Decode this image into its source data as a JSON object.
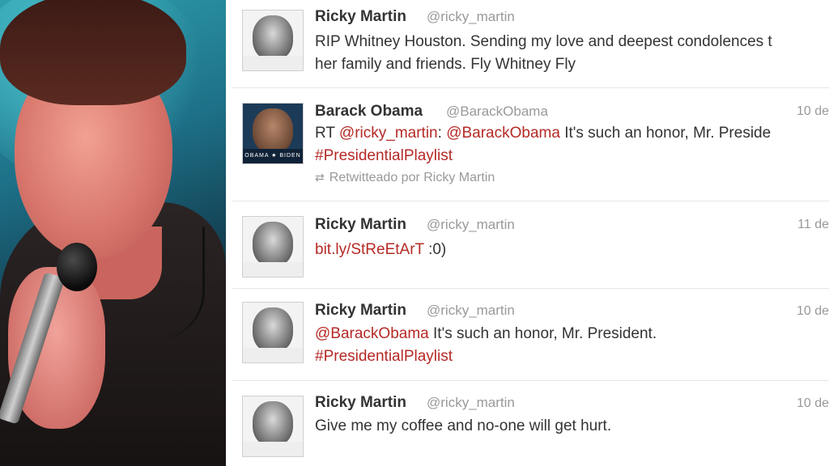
{
  "tweets": [
    {
      "name": "Ricky Martin",
      "handle": "@ricky_martin",
      "date": "",
      "text_line1": "RIP Whitney Houston. Sending my love and deepest condolences t",
      "text_line2": "her family and friends. Fly Whitney Fly",
      "avatar": "ricky-avatar"
    },
    {
      "name": "Barack Obama",
      "handle": "@BarackObama",
      "date": "10 de",
      "rt_prefix": "RT ",
      "mention1": "@ricky_martin",
      "colon": ": ",
      "mention2": "@BarackObama",
      "rest": " It's such an honor, Mr. Preside",
      "hashtag": "#PresidentialPlaylist",
      "retweeted_by": "Retwitteado por Ricky Martin",
      "avatar_tag": "OBAMA ★ BIDEN"
    },
    {
      "name": "Ricky Martin",
      "handle": "@ricky_martin",
      "date": "11 de",
      "link": "bit.ly/StReEtArT",
      "rest": " :0)"
    },
    {
      "name": "Ricky Martin",
      "handle": "@ricky_martin",
      "date": "10 de",
      "mention": "@BarackObama",
      "rest": " It's such an honor, Mr. President.",
      "hashtag": "#PresidentialPlaylist"
    },
    {
      "name": "Ricky Martin",
      "handle": "@ricky_martin",
      "date": "10 de",
      "text": "Give me my coffee and no-one will get hurt."
    }
  ],
  "icons": {
    "retweet": "retweet-icon"
  },
  "colors": {
    "link": "#b52a26",
    "name": "#333333",
    "meta": "#999999"
  }
}
